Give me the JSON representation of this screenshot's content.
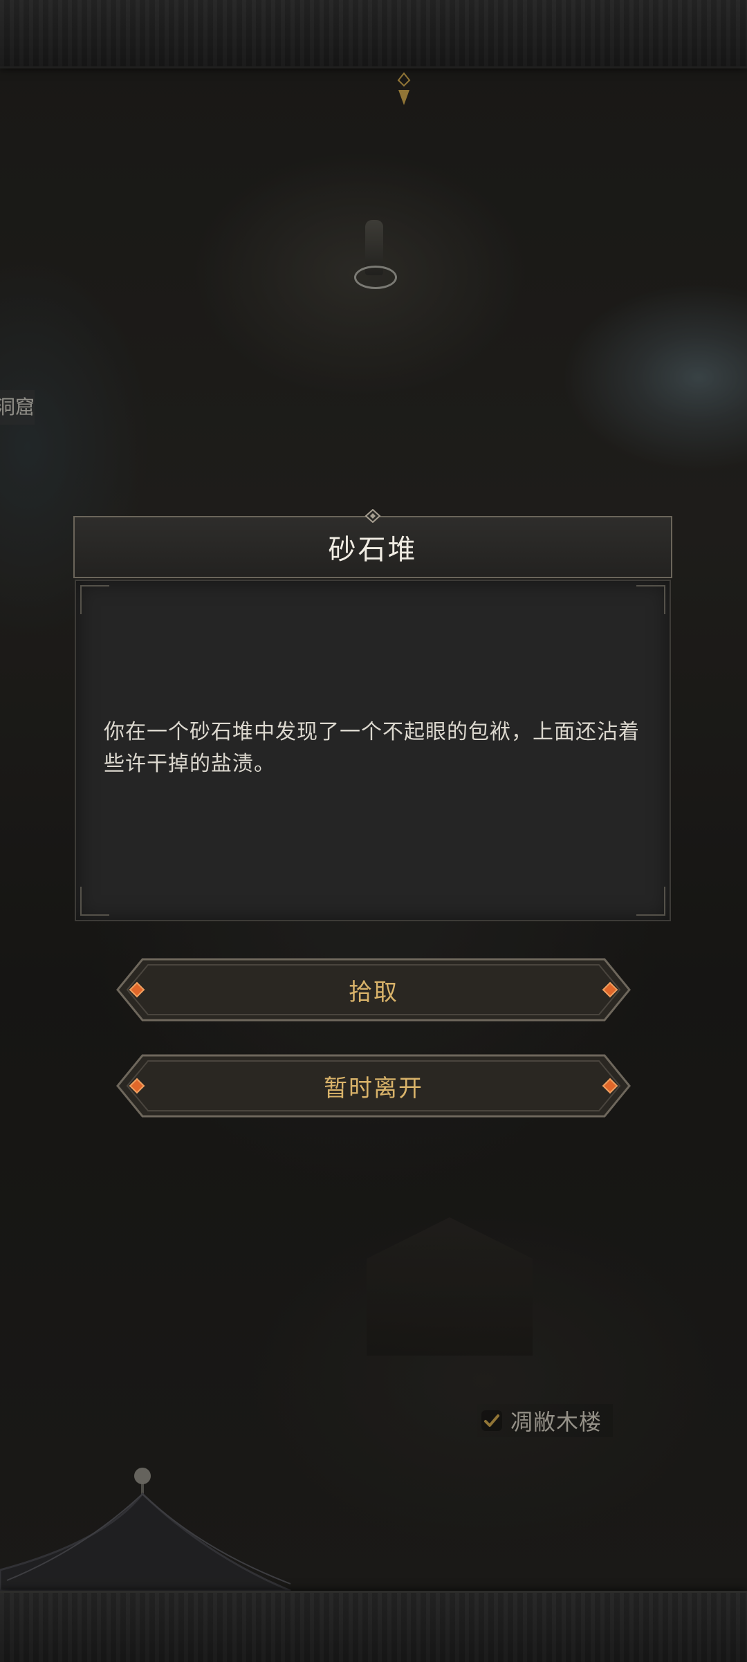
{
  "map": {
    "side_location_label": "洞窟",
    "location_label": "凋敝木楼"
  },
  "dialog": {
    "title": "砂石堆",
    "text": "你在一个砂石堆中发现了一个不起眼的包袱，上面还沾着些许干掉的盐渍。"
  },
  "choices": [
    {
      "label": "拾取"
    },
    {
      "label": "暂时离开"
    }
  ],
  "icons": {
    "top_marker": "map-pointer-icon",
    "location_check": "check-icon",
    "button_gem": "diamond-gem-icon"
  },
  "colors": {
    "accent_gold": "#d9b36a",
    "gem_orange": "#e0672a",
    "check_gold": "#c9a24c"
  }
}
